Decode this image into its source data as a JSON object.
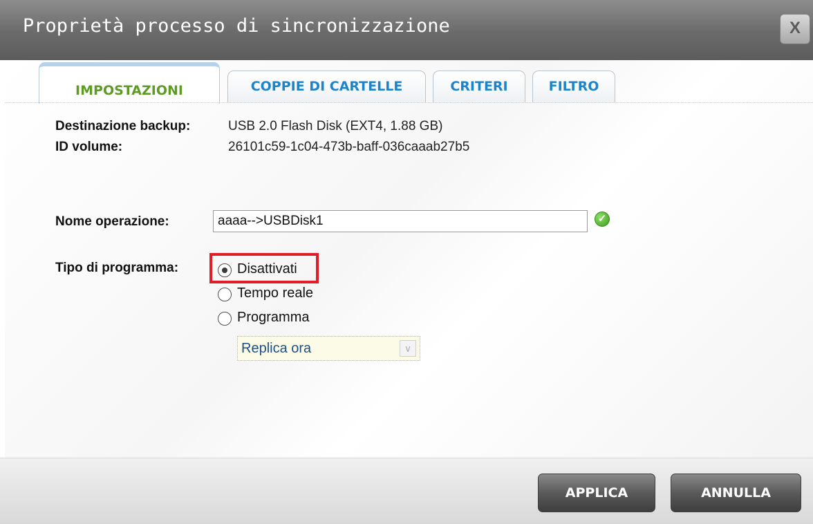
{
  "window": {
    "title": "Proprietà processo di sincronizzazione",
    "close_label": "X"
  },
  "tabs": [
    {
      "label": "IMPOSTAZIONI",
      "active": true
    },
    {
      "label": "COPPIE DI CARTELLE",
      "active": false
    },
    {
      "label": "CRITERI",
      "active": false
    },
    {
      "label": "FILTRO",
      "active": false
    }
  ],
  "info": {
    "destination_label": "Destinazione backup:",
    "destination_value": "USB 2.0 Flash Disk (EXT4, 1.88 GB)",
    "volume_label": "ID volume:",
    "volume_value": "26101c59-1c04-473b-baff-036caaab27b5"
  },
  "operation": {
    "label": "Nome operazione:",
    "value": "aaaa-->USBDisk1",
    "valid_icon": "check-circle-icon"
  },
  "schedule": {
    "label": "Tipo di programma:",
    "options": [
      {
        "label": "Disattivati",
        "selected": true
      },
      {
        "label": "Tempo reale",
        "selected": false
      },
      {
        "label": "Programma",
        "selected": false
      }
    ],
    "select_value": "Replica ora"
  },
  "buttons": {
    "apply": "APPLICA",
    "cancel": "ANNULLA"
  },
  "colors": {
    "active_tab": "#5d9b24",
    "tab_text": "#1e84c9",
    "highlight": "#e11d2a"
  }
}
